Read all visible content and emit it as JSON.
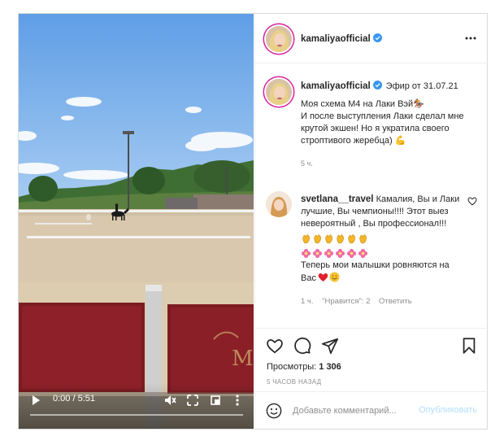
{
  "video": {
    "time": "0:00 / 5:51",
    "progress": 0,
    "icons": [
      "play-icon",
      "mute-icon",
      "pip-icon",
      "fullscreen-icon",
      "more-vertical-icon"
    ]
  },
  "post": {
    "author": "kamaliyaofficial",
    "verified": true,
    "caption": {
      "username": "kamaliyaofficial",
      "meta": "Эфир от 31.07.21",
      "text": "Моя схема М4 на Лаки Вэй🏇\nИ после выступления Лаки сделал мне крутой экшен! Но я укратила своего строптивого жеребца) 💪",
      "age": "5 ч."
    },
    "comments": [
      {
        "username": "svetlana__travel",
        "text": "Камалия, Вы и Лаки лучшие, Вы чемпионы!!!! Этот выез невероятный , Вы профессионал!!!",
        "emoji_rows": [
          [
            "clap-emoji",
            "clap-emoji",
            "clap-emoji",
            "clap-emoji",
            "clap-emoji",
            "clap-emoji"
          ],
          [
            "flower-emoji",
            "flower-emoji",
            "flower-emoji",
            "flower-emoji",
            "flower-emoji",
            "flower-emoji"
          ]
        ],
        "text2": "Теперь мои малышки ровняются на Вас",
        "age": "1 ч.",
        "likes": "\"Нравится\": 2",
        "reply": "Ответить"
      }
    ],
    "views_label": "Просмотры:",
    "views_count": "1 306",
    "date": "5 ЧАСОВ НАЗАД",
    "comment_placeholder": "Добавьте комментарий...",
    "publish_label": "Опубликовать",
    "colors": {
      "link": "#0095f6",
      "publish_disabled": "#b2dffc",
      "verified": "#3897f0",
      "muted": "#8e8e8e"
    }
  }
}
